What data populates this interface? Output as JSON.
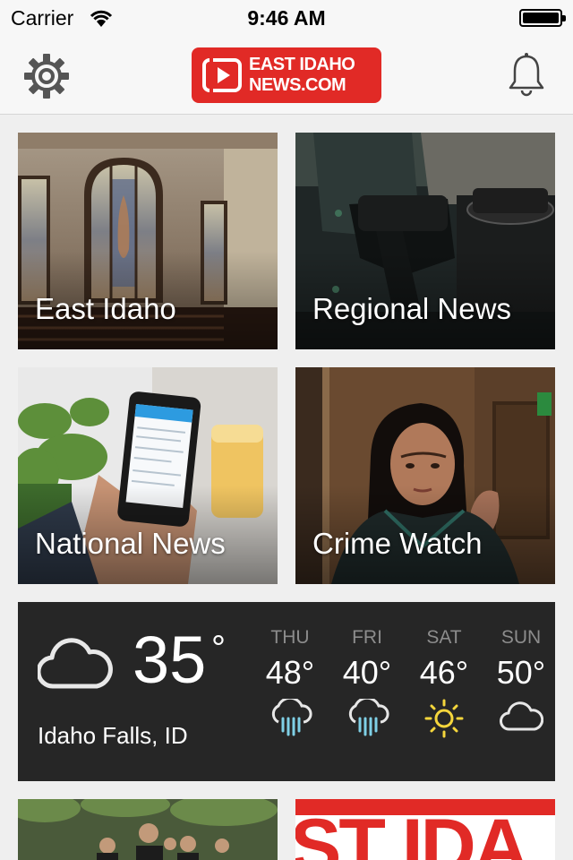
{
  "status_bar": {
    "carrier": "Carrier",
    "time": "9:46 AM"
  },
  "header": {
    "logo_line1": "EAST IDAHO",
    "logo_line2": "NEWS.COM",
    "settings_icon": "gear-icon",
    "notifications_icon": "bell-icon",
    "brand_color": "#e12a26"
  },
  "tiles": [
    {
      "label": "East Idaho"
    },
    {
      "label": "Regional News"
    },
    {
      "label": "National News"
    },
    {
      "label": "Crime Watch"
    }
  ],
  "weather": {
    "current_temp": "35",
    "degree": "°",
    "current_icon": "cloud-icon",
    "location": "Idaho Falls, ID",
    "forecast": [
      {
        "day": "THU",
        "temp": "48°",
        "icon": "rain-icon"
      },
      {
        "day": "FRI",
        "temp": "40°",
        "icon": "rain-icon"
      },
      {
        "day": "SAT",
        "temp": "46°",
        "icon": "sun-icon"
      },
      {
        "day": "SUN",
        "temp": "50°",
        "icon": "cloud-icon"
      }
    ]
  },
  "bottom_tiles": {
    "brand_text": "ST IDA"
  }
}
